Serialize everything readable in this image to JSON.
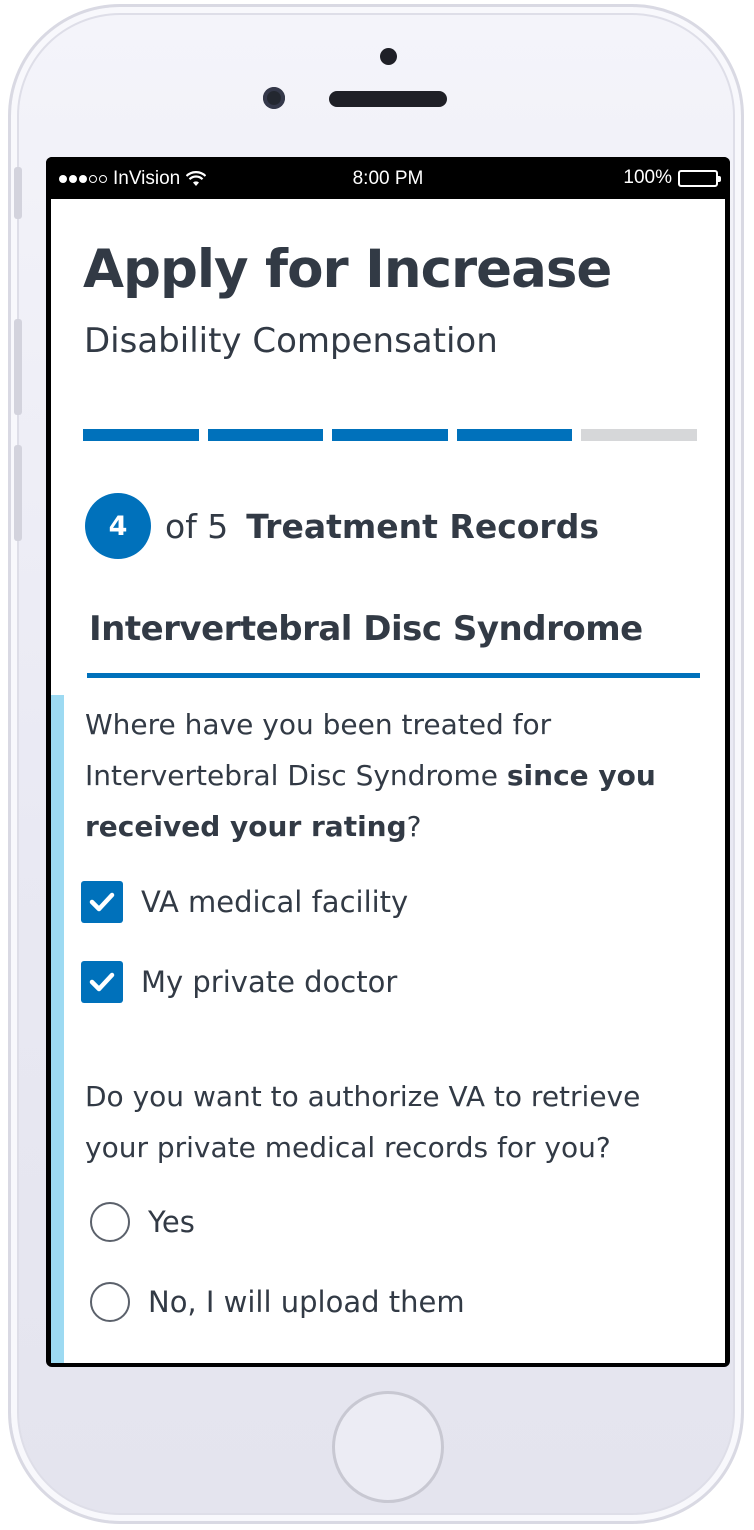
{
  "status_bar": {
    "carrier": "InVision",
    "time": "8:00 PM",
    "battery": "100%",
    "icons": [
      "signal-dots-icon",
      "wifi-icon",
      "battery-icon"
    ]
  },
  "header": {
    "title": "Apply for Increase",
    "subtitle": "Disability Compensation"
  },
  "progress": {
    "total_steps": 5,
    "completed_steps": 4,
    "colors": {
      "complete": "#0071bb",
      "incomplete": "#d6d7d9"
    }
  },
  "step": {
    "number": "4",
    "of_label": "of 5",
    "title": "Treatment Records"
  },
  "section": {
    "heading": "Intervertebral Disc Syndrome"
  },
  "question1": {
    "text_part1": "Where have you been treated for Intervertebral Disc Syndrome ",
    "text_bold1": "since you received your rating",
    "text_part2": "?",
    "options": [
      {
        "label": "VA medical facility",
        "checked": true
      },
      {
        "label": "My private doctor",
        "checked": true
      }
    ]
  },
  "question2": {
    "text": "Do you want to authorize VA to retrieve your private medical records for you?",
    "options": [
      {
        "label": "Yes",
        "selected": false
      },
      {
        "label": "No, I will upload them",
        "selected": false
      }
    ]
  },
  "colors": {
    "primary": "#0071bb",
    "text": "#323a45",
    "accent_bar": "#9ddaf2"
  }
}
